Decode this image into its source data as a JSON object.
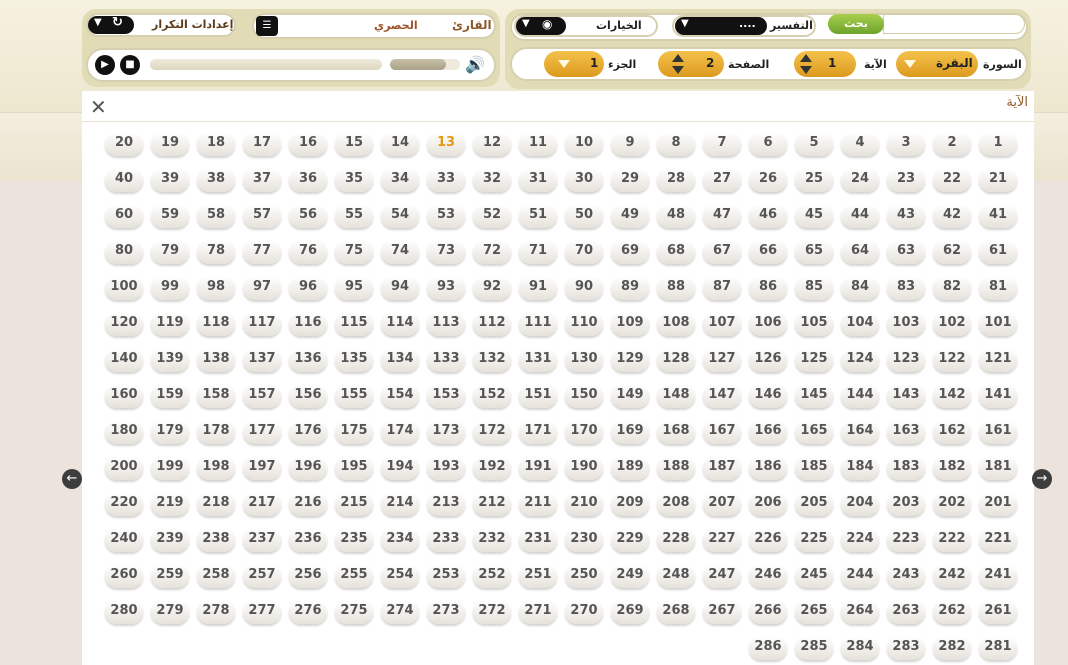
{
  "toolbar": {
    "search_label": "بحث",
    "tafsir_label": "التفسير",
    "tafsir_value": "....",
    "options_label": "الخيارات",
    "reader_label": "القارئ",
    "reader_value": "الحصري",
    "repeat_label": "إعدادات التكرار",
    "surah_label": "السورة",
    "surah_value": "البقرة",
    "ayah_label": "الآية",
    "ayah_value": "1",
    "page_label": "الصفحة",
    "page_value": "2",
    "juz_label": "الجزء",
    "juz_value": "1"
  },
  "panel": {
    "title": "الآية",
    "active_verse": "13",
    "total_verses": 286
  },
  "colors": {
    "accent": "#e49a12",
    "search_green": "#86bb3a",
    "gold": "#e8ad32"
  },
  "icons": [
    "close-icon",
    "arrow-left-icon",
    "arrow-right-icon",
    "play-icon",
    "stop-icon",
    "speaker-icon",
    "eye-icon",
    "list-icon",
    "repeat-icon"
  ]
}
